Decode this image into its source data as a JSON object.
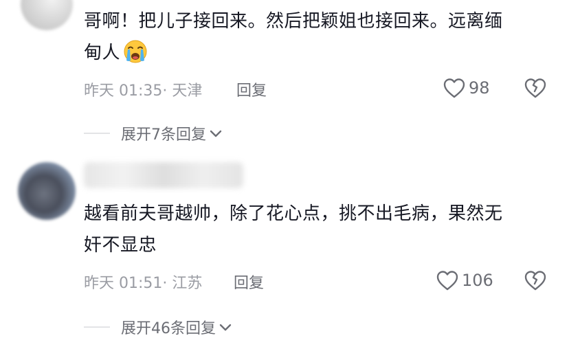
{
  "comments": [
    {
      "text_line1": "哥啊！把儿子接回来。然后把颖姐也接回来。远离缅",
      "text_line2": "甸人",
      "emoji": "loudly-crying-face",
      "time_location": "昨天 01:35· 天津",
      "reply_label": "回复",
      "like_count": "98",
      "expand_label": "展开7条回复"
    },
    {
      "text_line1": "越看前夫哥越帅，除了花心点，挑不出毛病，果然无",
      "text_line2": "奸不显忠",
      "time_location": "昨天 01:51· 江苏",
      "reply_label": "回复",
      "like_count": "106",
      "expand_label": "展开46条回复"
    }
  ],
  "colors": {
    "text_primary": "#161823",
    "text_secondary": "#9a9ca3",
    "text_action": "#6b6d74",
    "divider": "#e3e4e6",
    "emoji_face": "#ffc83d"
  }
}
